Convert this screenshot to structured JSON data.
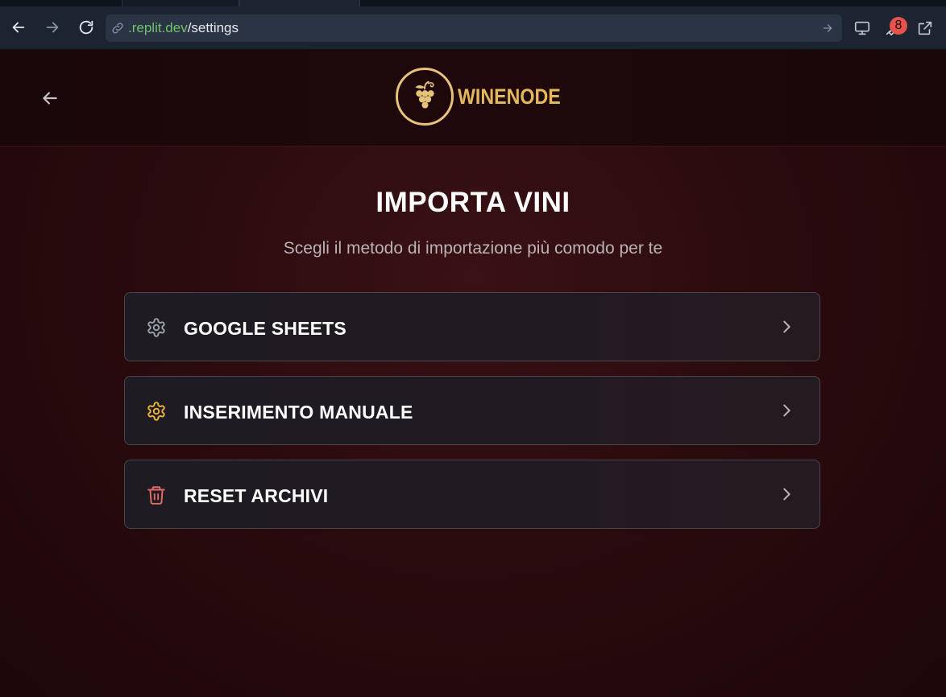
{
  "browser": {
    "url_host": ".replit.dev",
    "url_path": "/settings",
    "badge_count": "8",
    "icons": {
      "back": "arrow-left-icon",
      "forward": "arrow-right-icon",
      "reload": "reload-icon",
      "link": "link-icon",
      "go": "go-arrow-icon",
      "monitor": "monitor-icon",
      "tools": "wrench-icon",
      "open_external": "external-link-icon"
    }
  },
  "app": {
    "logo_text": "WINENODE",
    "back_icon": "arrow-left-icon",
    "title": "IMPORTA VINI",
    "subtitle": "Scegli il metodo di importazione più comodo per te",
    "options": [
      {
        "label": "GOOGLE SHEETS",
        "icon": "gear-icon",
        "icon_color": "#9aa0a8"
      },
      {
        "label": "INSERIMENTO MANUALE",
        "icon": "gear-icon",
        "icon_color": "#e8b33c"
      },
      {
        "label": "RESET ARCHIVI",
        "icon": "trash-icon",
        "icon_color": "#e06a66"
      }
    ],
    "colors": {
      "brand_gold": "#e3b85c",
      "background": "#2a0b0e"
    }
  }
}
